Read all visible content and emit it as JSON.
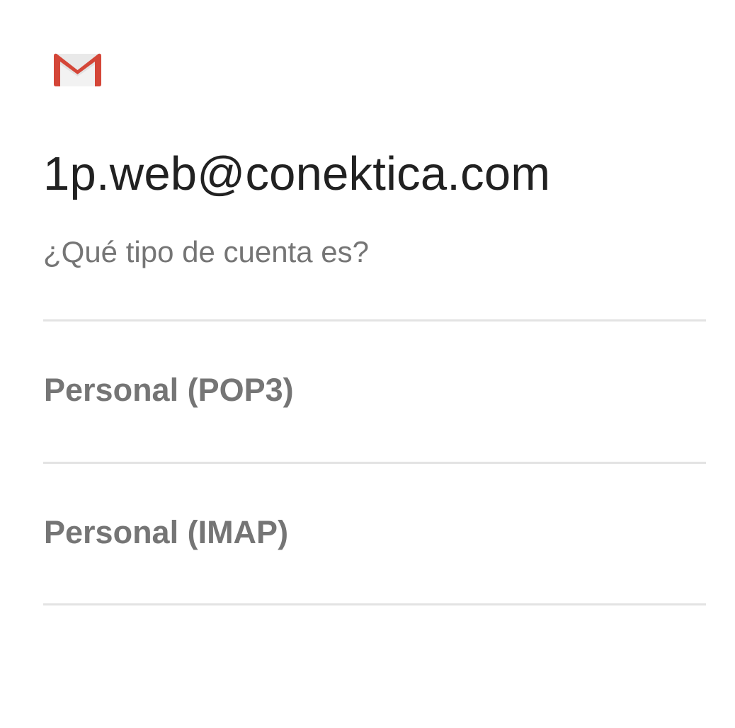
{
  "header": {
    "logo_icon": "gmail-logo-icon",
    "brand_color": "#D44638"
  },
  "account": {
    "email": "1p.web@conektica.com",
    "question": "¿Qué tipo de cuenta es?"
  },
  "account_types": [
    {
      "label": "Personal (POP3)"
    },
    {
      "label": "Personal (IMAP)"
    }
  ],
  "colors": {
    "primary_text": "#212121",
    "secondary_text": "#757575",
    "divider": "#E3E3E3"
  }
}
